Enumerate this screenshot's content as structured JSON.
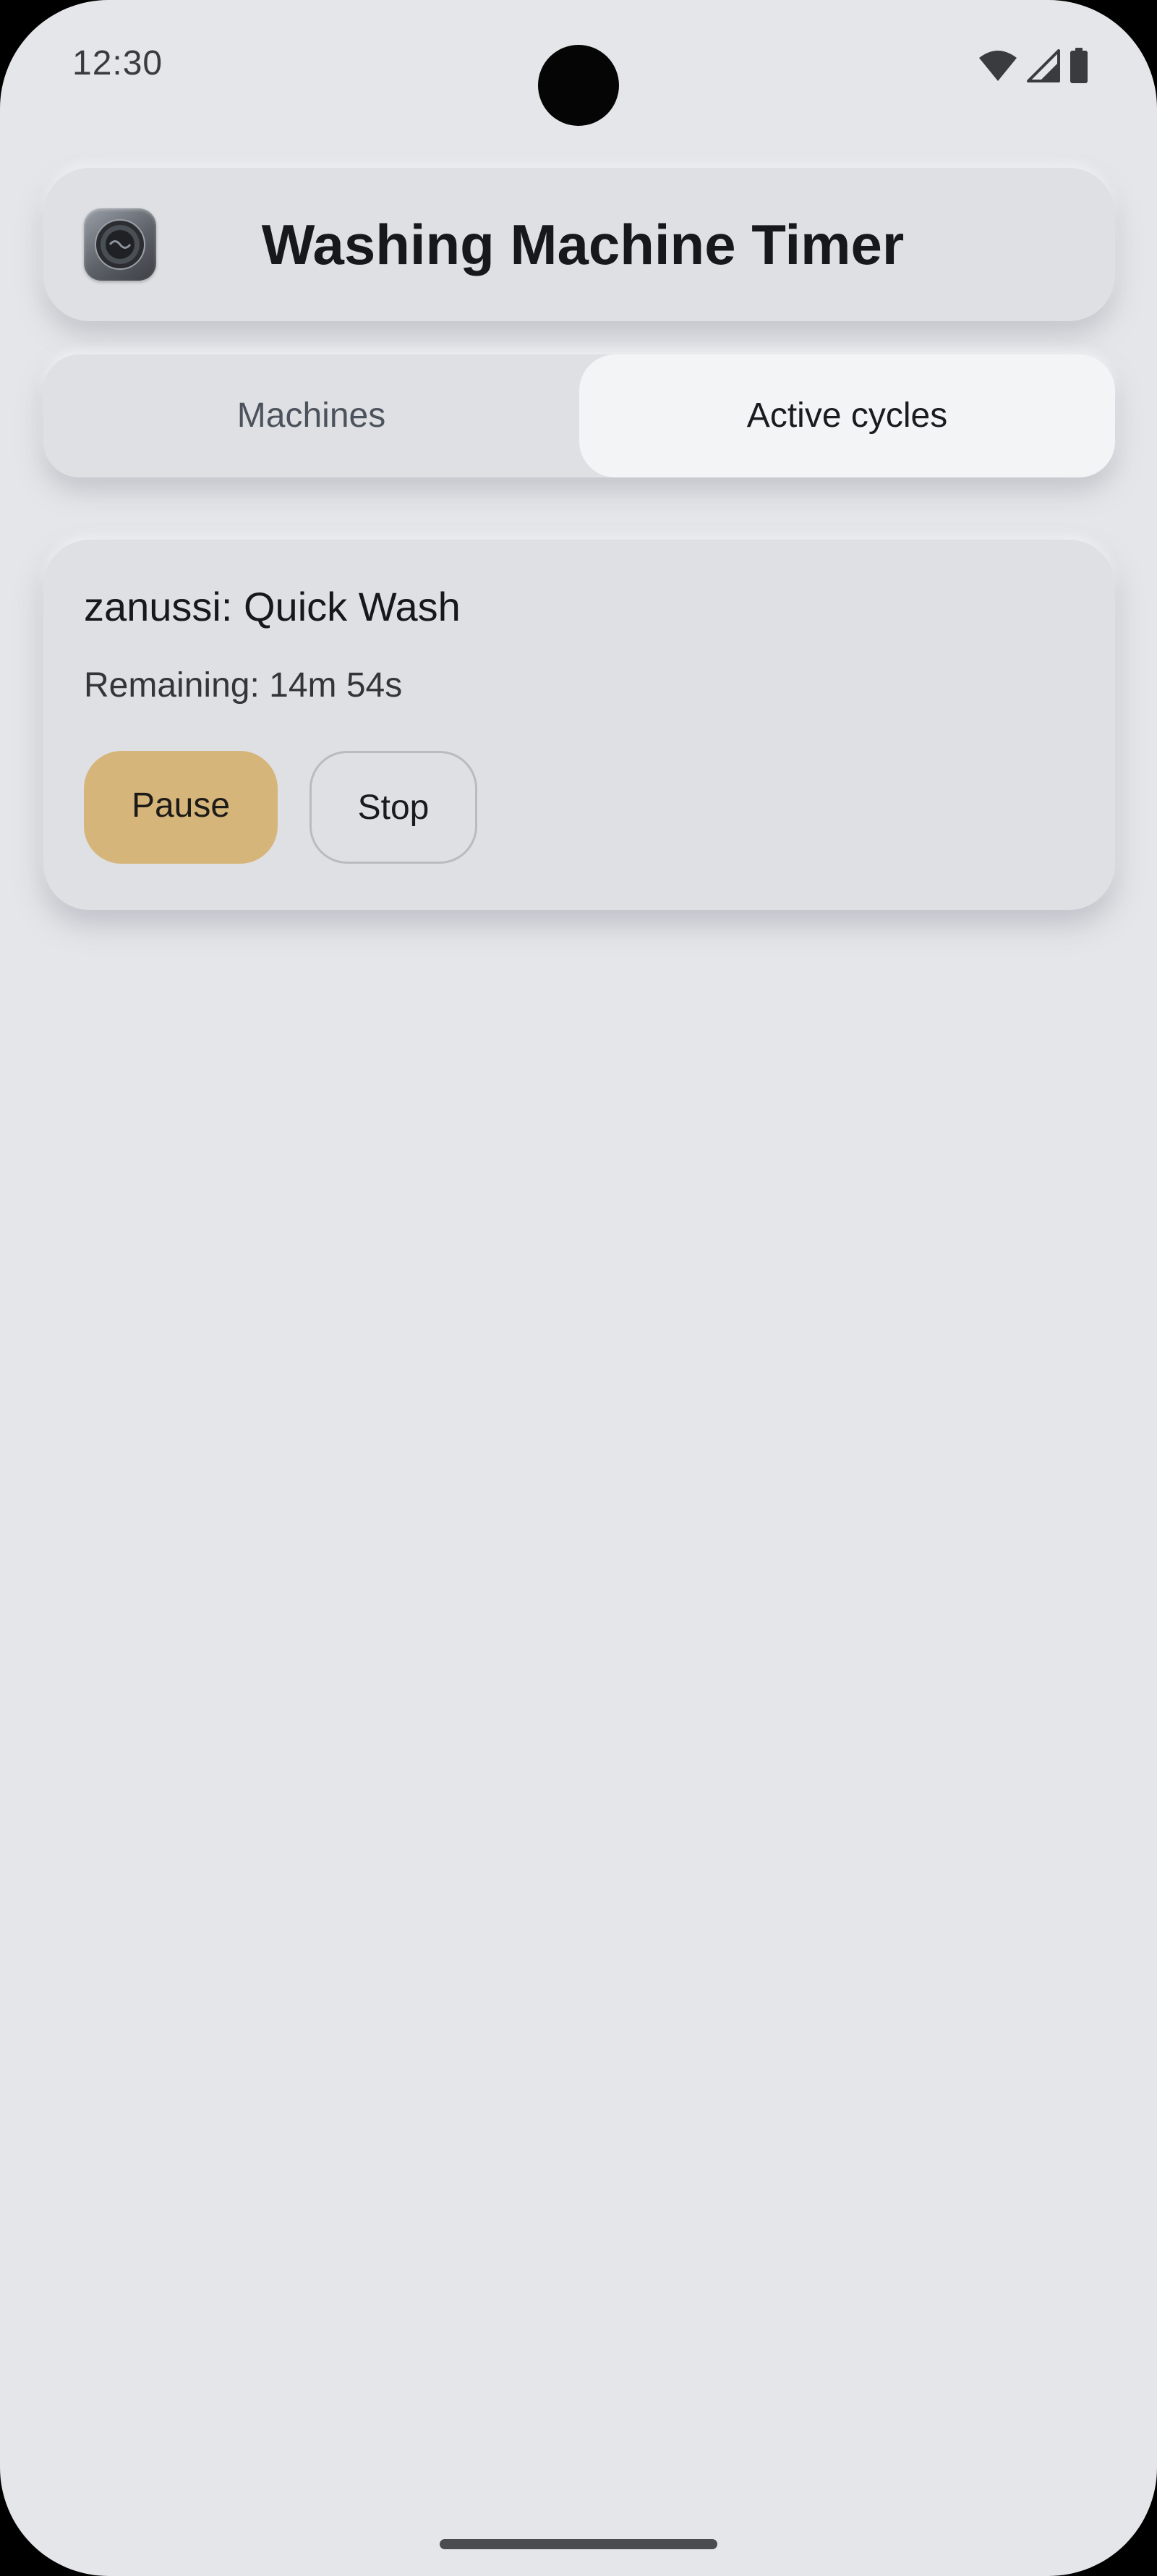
{
  "status_bar": {
    "time": "12:30",
    "icons": [
      "wifi-icon",
      "cell-signal-icon",
      "battery-icon"
    ]
  },
  "header": {
    "app_icon": "washing-machine-icon",
    "title": "Washing Machine Timer"
  },
  "tabs": [
    {
      "label": "Machines",
      "active": false
    },
    {
      "label": "Active cycles",
      "active": true
    }
  ],
  "active_cycle": {
    "title": "zanussi: Quick Wash",
    "remaining": "Remaining: 14m 54s",
    "pause_label": "Pause",
    "stop_label": "Stop"
  },
  "colors": {
    "background": "#e5e6e9",
    "card": "#dfe0e4",
    "active_tab": "#f3f4f6",
    "pause_button": "#d6b57b",
    "stop_border": "#b9bbc1"
  }
}
